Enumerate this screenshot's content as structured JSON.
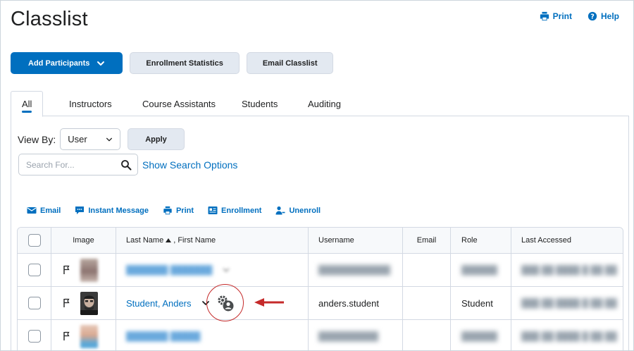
{
  "header": {
    "title": "Classlist",
    "print_label": "Print",
    "help_label": "Help"
  },
  "toolbar": {
    "add_participants": "Add Participants",
    "enrollment_statistics": "Enrollment Statistics",
    "email_classlist": "Email Classlist"
  },
  "tabs": [
    {
      "label": "All",
      "active": true
    },
    {
      "label": "Instructors",
      "active": false
    },
    {
      "label": "Course Assistants",
      "active": false
    },
    {
      "label": "Students",
      "active": false
    },
    {
      "label": "Auditing",
      "active": false
    }
  ],
  "filter": {
    "view_by_label": "View By:",
    "view_by_value": "User",
    "apply_label": "Apply",
    "search_placeholder": "Search For...",
    "search_options_label": "Show Search Options"
  },
  "actions": {
    "email": "Email",
    "instant_message": "Instant Message",
    "print": "Print",
    "enrollment": "Enrollment",
    "unenroll": "Unenroll"
  },
  "table": {
    "headers": {
      "image": "Image",
      "last_name": "Last Name",
      "first_name": ", First Name",
      "username": "Username",
      "email": "Email",
      "role": "Role",
      "last_accessed": "Last Accessed"
    },
    "student_row": {
      "name": "Student, Anders",
      "username": "anders.student",
      "role": "Student"
    }
  },
  "colors": {
    "accent": "#006fbf",
    "highlight": "#c52a2a"
  }
}
